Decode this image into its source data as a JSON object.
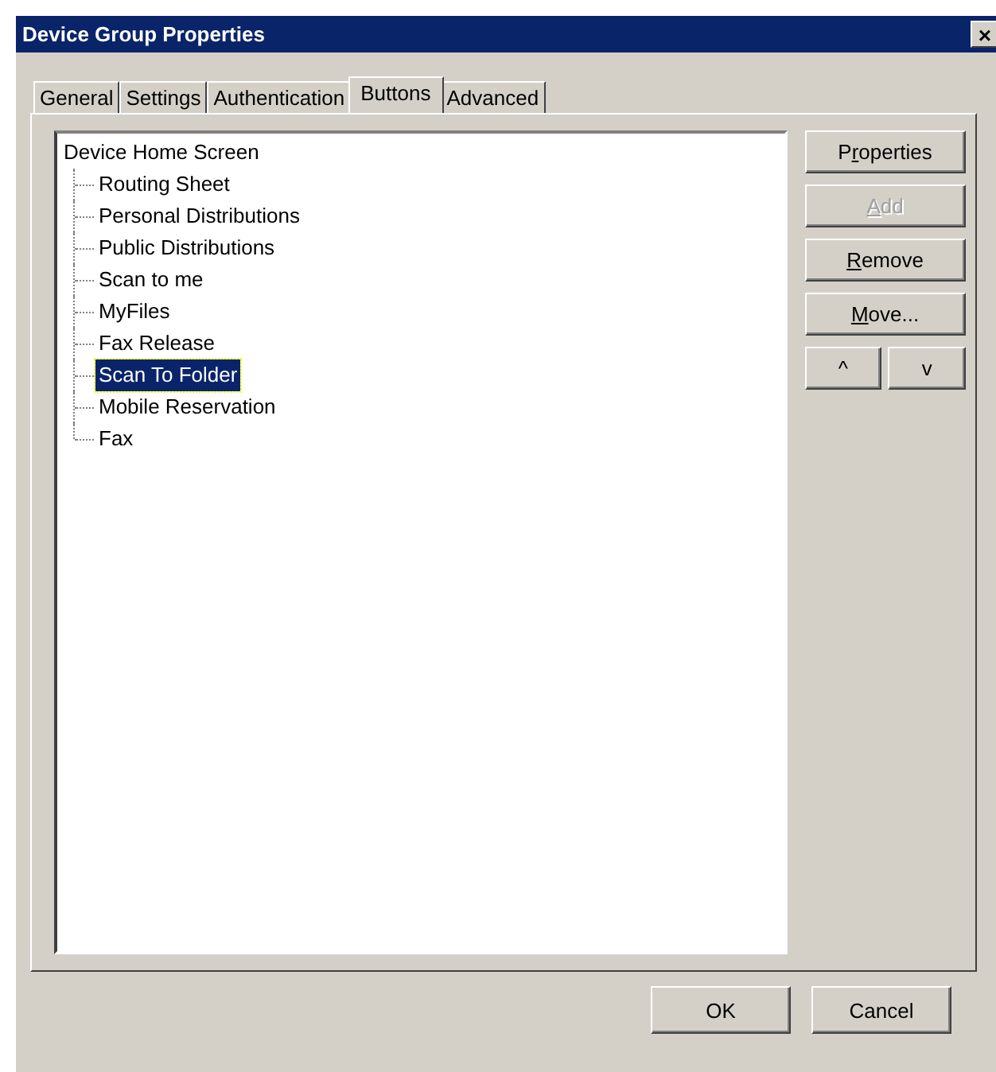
{
  "window": {
    "title": "Device Group Properties",
    "close": "×"
  },
  "tabs": [
    {
      "label": "General",
      "selected": false
    },
    {
      "label": "Settings",
      "selected": false
    },
    {
      "label": "Authentication",
      "selected": false
    },
    {
      "label": "Buttons",
      "selected": true
    },
    {
      "label": "Advanced",
      "selected": false
    }
  ],
  "tree": {
    "label": "Device Home Screen",
    "selected": false,
    "children": [
      {
        "label": "Routing Sheet",
        "selected": false
      },
      {
        "label": "Personal Distributions",
        "selected": false
      },
      {
        "label": "Public Distributions",
        "selected": false
      },
      {
        "label": "Scan to me",
        "selected": false
      },
      {
        "label": "MyFiles",
        "selected": false
      },
      {
        "label": "Fax Release",
        "selected": false
      },
      {
        "label": "Scan To Folder",
        "selected": true
      },
      {
        "label": "Mobile Reservation",
        "selected": false
      },
      {
        "label": "Fax",
        "selected": false
      }
    ]
  },
  "side_buttons": [
    {
      "label_start": "P",
      "access_key": "r",
      "label_end": "operties",
      "disabled": false
    },
    {
      "access_key": "A",
      "label_end": "dd",
      "disabled": true
    },
    {
      "access_key": "R",
      "label_end": "emove",
      "disabled": false
    },
    {
      "access_key": "M",
      "label_end": "ove...",
      "disabled": false
    }
  ],
  "order_buttons": [
    "^",
    "v"
  ],
  "footer_buttons": [
    "OK",
    "Cancel"
  ]
}
